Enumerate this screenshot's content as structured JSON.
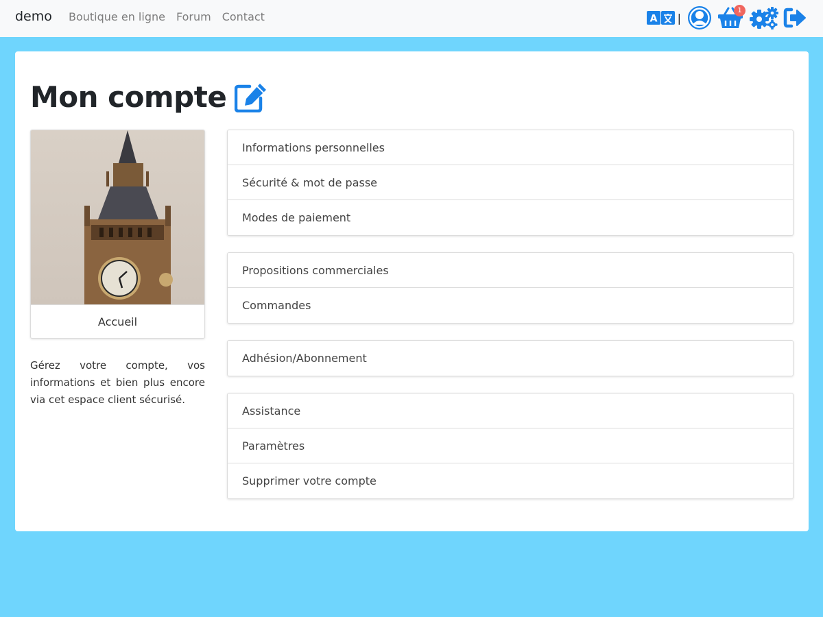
{
  "navbar": {
    "brand": "demo",
    "links": [
      "Boutique en ligne",
      "Forum",
      "Contact"
    ],
    "separator": "|",
    "cart_count": "1",
    "icons": [
      "translate-icon",
      "user-icon",
      "basket-icon",
      "gears-icon",
      "logout-icon"
    ],
    "accent": "#1a82e8"
  },
  "main": {
    "title": "Mon compte",
    "profile_caption": "Accueil",
    "description": "Gérez votre compte, vos informations et bien plus encore via cet espace client sécurisé.",
    "groups": [
      [
        "Informations personnelles",
        "Sécurité & mot de passe",
        "Modes de paiement"
      ],
      [
        "Propositions commerciales",
        "Commandes"
      ],
      [
        "Adhésion/Abonnement"
      ],
      [
        "Assistance",
        "Paramètres",
        "Supprimer votre compte"
      ]
    ]
  },
  "colors": {
    "background": "#6fd5fd",
    "navbar": "#f8f9fa",
    "badge": "#f0665e"
  }
}
